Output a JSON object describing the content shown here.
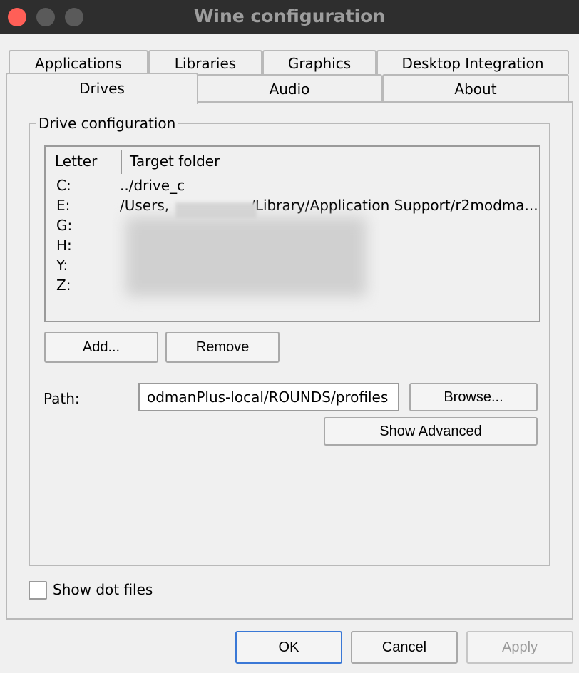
{
  "window": {
    "title": "Wine configuration",
    "colors": {
      "close": "#ff5f57",
      "inactive": "#5a5a5a",
      "titlebar": "#2e2e2e"
    }
  },
  "tabs": {
    "row1": [
      "Applications",
      "Libraries",
      "Graphics",
      "Desktop Integration"
    ],
    "row2": [
      "Drives",
      "Audio",
      "About"
    ],
    "active": "Drives"
  },
  "drives": {
    "group_label": "Drive configuration",
    "columns": {
      "letter": "Letter",
      "target": "Target folder"
    },
    "rows": [
      {
        "letter": "C:",
        "target": "../drive_c"
      },
      {
        "letter": "E:",
        "target_start": "/Users,",
        "target_end": "/Library/Application Support/r2modma..."
      },
      {
        "letter": "G:",
        "target": ""
      },
      {
        "letter": "H:",
        "target": ""
      },
      {
        "letter": "Y:",
        "target": ""
      },
      {
        "letter": "Z:",
        "target": ""
      }
    ],
    "add_label": "Add...",
    "remove_label": "Remove",
    "path_label": "Path:",
    "path_value": "odmanPlus-local/ROUNDS/profiles",
    "browse_label": "Browse...",
    "show_advanced_label": "Show Advanced"
  },
  "show_dot_files": {
    "label": "Show dot files",
    "checked": false
  },
  "footer": {
    "ok": "OK",
    "cancel": "Cancel",
    "apply": "Apply"
  }
}
